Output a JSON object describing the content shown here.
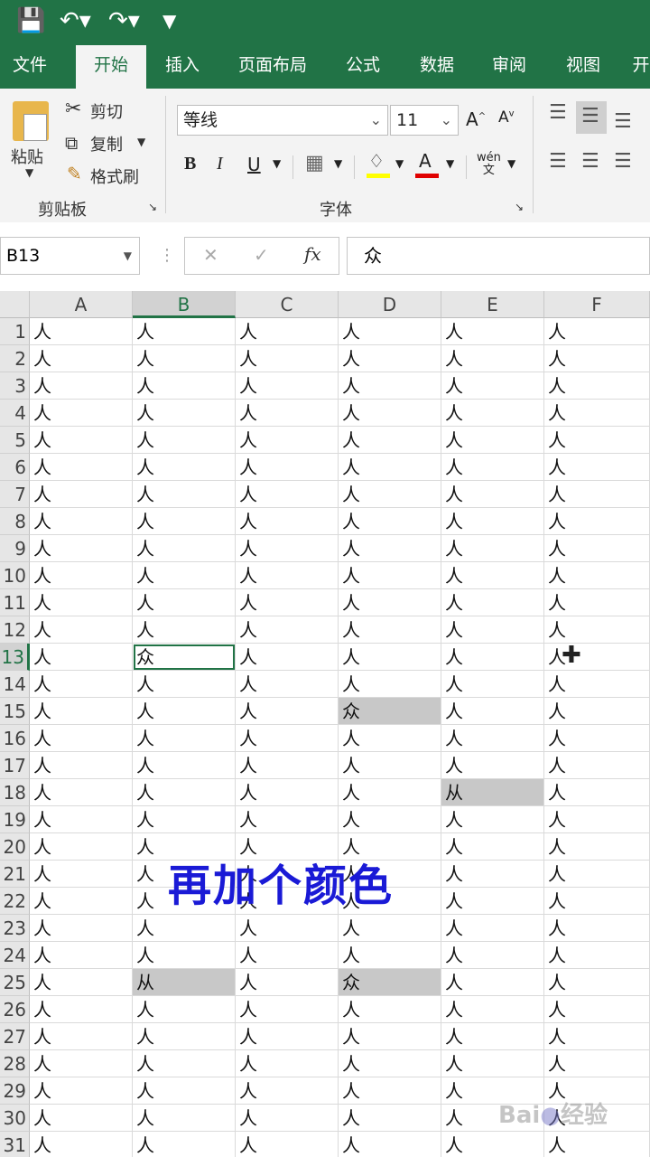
{
  "quick_access": {
    "save_icon": "save-icon",
    "undo_icon": "undo-icon",
    "redo_icon": "redo-icon",
    "customize_icon": "customize-qat-icon"
  },
  "tabs": [
    {
      "label": "文件",
      "active": false
    },
    {
      "label": "开始",
      "active": true
    },
    {
      "label": "插入",
      "active": false
    },
    {
      "label": "页面布局",
      "active": false
    },
    {
      "label": "公式",
      "active": false
    },
    {
      "label": "数据",
      "active": false
    },
    {
      "label": "审阅",
      "active": false
    },
    {
      "label": "视图",
      "active": false
    },
    {
      "label": "开",
      "active": false
    }
  ],
  "ribbon": {
    "clipboard": {
      "paste_label": "粘贴",
      "cut_label": "剪切",
      "copy_label": "复制",
      "format_painter_label": "格式刷",
      "group_label": "剪贴板"
    },
    "font": {
      "font_name": "等线",
      "font_size": "11",
      "bold": "B",
      "italic": "I",
      "underline": "U",
      "phonetic": "wén",
      "group_label": "字体"
    }
  },
  "formula_bar": {
    "name_box": "B13",
    "cancel_symbol": "✕",
    "enter_symbol": "✓",
    "fx_label": "fx",
    "value": "众"
  },
  "sheet": {
    "columns": [
      "A",
      "B",
      "C",
      "D",
      "E",
      "F"
    ],
    "selected_column": "B",
    "selected_row": 13,
    "row_start": 1,
    "row_count": 31,
    "default_value": "人",
    "special_cells": [
      {
        "row": 13,
        "col": "B",
        "value": "众",
        "highlight": false,
        "active": true
      },
      {
        "row": 15,
        "col": "D",
        "value": "众",
        "highlight": true,
        "active": false
      },
      {
        "row": 18,
        "col": "E",
        "value": "从",
        "highlight": true,
        "active": false
      },
      {
        "row": 25,
        "col": "B",
        "value": "从",
        "highlight": true,
        "active": false
      },
      {
        "row": 25,
        "col": "D",
        "value": "众",
        "highlight": true,
        "active": false
      }
    ]
  },
  "overlay_text": "再加个颜色",
  "watermark": "Baidu经验",
  "colors": {
    "excel_green": "#217346",
    "overlay_blue": "#1a1ad6",
    "highlight_gray": "#c8c8c8"
  }
}
